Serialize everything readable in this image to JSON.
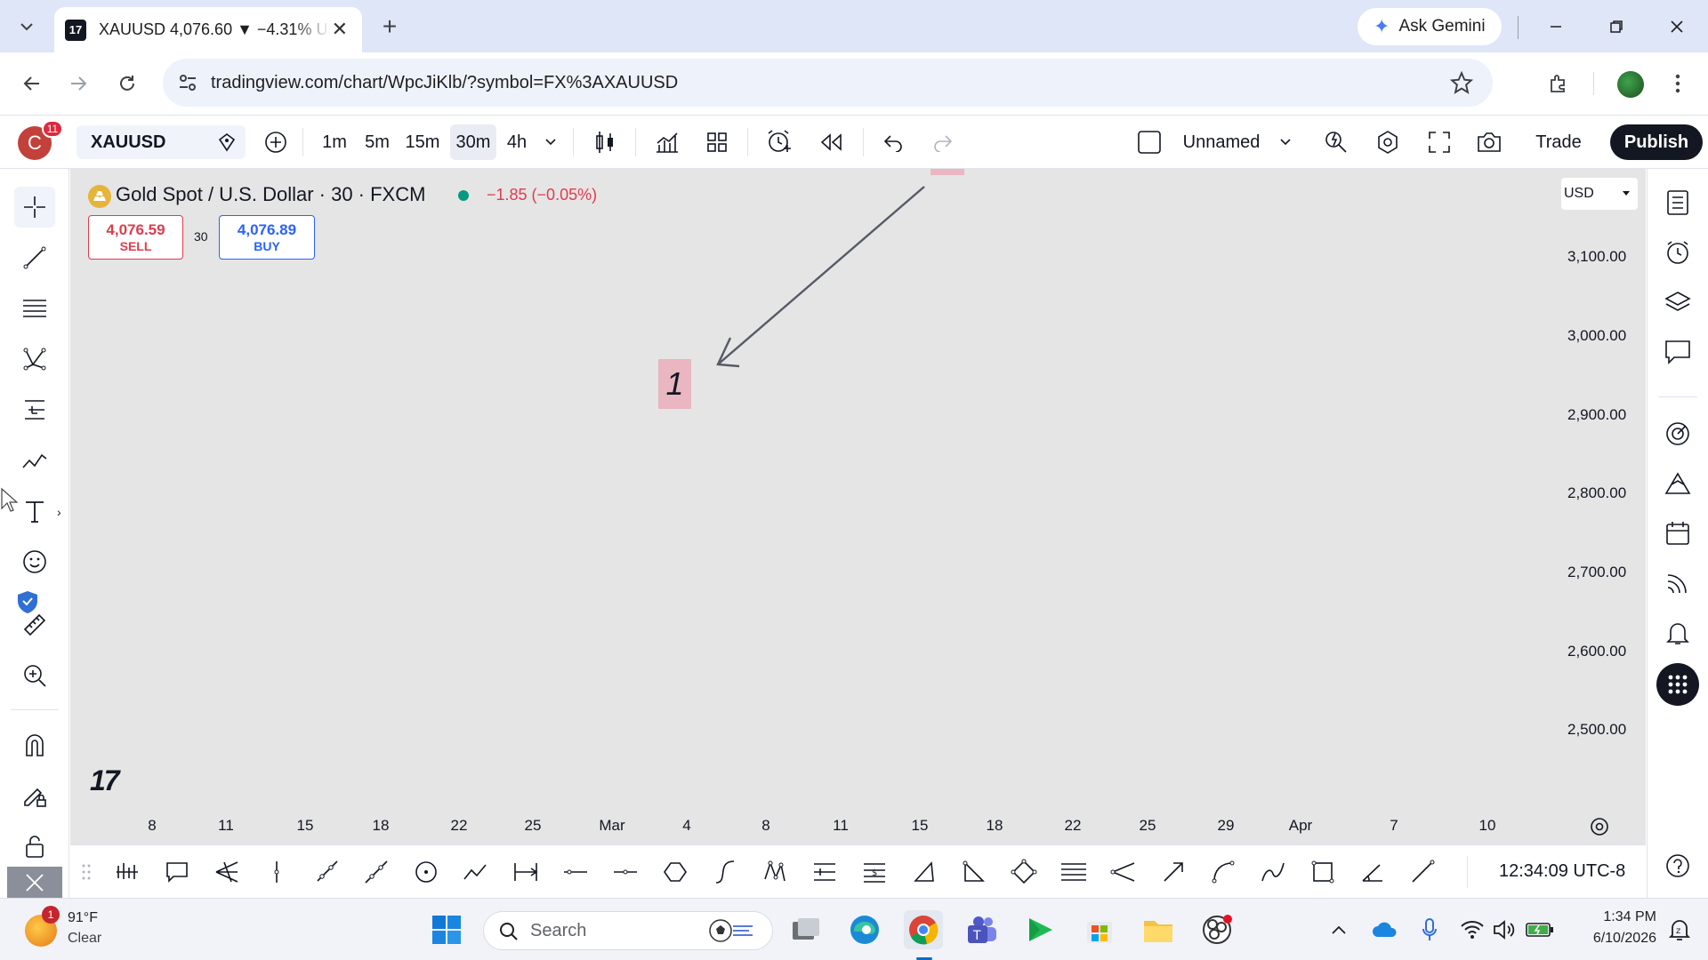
{
  "browser": {
    "tab_title": "XAUUSD 4,076.60 ▼ −4.31% Ur",
    "tab_favicon": "17",
    "new_tab_label": "+",
    "ask_gemini_label": "Ask Gemini",
    "url": "tradingview.com/chart/WpcJiKlb/?symbol=FX%3AXAUUSD"
  },
  "toolbar": {
    "avatar_letter": "C",
    "notification_count": "11",
    "symbol": "XAUUSD",
    "intervals": [
      "1m",
      "5m",
      "15m",
      "30m",
      "4h"
    ],
    "active_interval": "30m",
    "layout_name": "Unnamed",
    "trade_label": "Trade",
    "publish_label": "Publish"
  },
  "legend": {
    "title": "Gold Spot / U.S. Dollar · 30 · FXCM",
    "change": "−1.85 (−0.05%)",
    "sell_price": "4,076.59",
    "sell_label": "SELL",
    "spread": "30",
    "buy_price": "4,076.89",
    "buy_label": "BUY"
  },
  "chart": {
    "currency": "USD",
    "price_labels": [
      "3,100.00",
      "3,000.00",
      "2,900.00",
      "2,800.00",
      "2,700.00",
      "2,600.00",
      "2,500.00"
    ],
    "time_labels": [
      "8",
      "11",
      "15",
      "18",
      "22",
      "25",
      "Mar",
      "4",
      "8",
      "11",
      "15",
      "18",
      "22",
      "25",
      "29",
      "Apr",
      "7",
      "10"
    ],
    "annotation_text": "1",
    "watermark": "17",
    "clock": "12:34:09 UTC-8",
    "colors": {
      "sell": "#e03b4d",
      "buy": "#2962ff",
      "annotation_bg": "#e9b6c2",
      "background": "#e5e5e5"
    }
  },
  "taskbar": {
    "weather_temp": "91°F",
    "weather_desc": "Clear",
    "weather_badge": "1",
    "search_placeholder": "Search",
    "time": "1:34 PM",
    "date": "6/10/2026"
  }
}
